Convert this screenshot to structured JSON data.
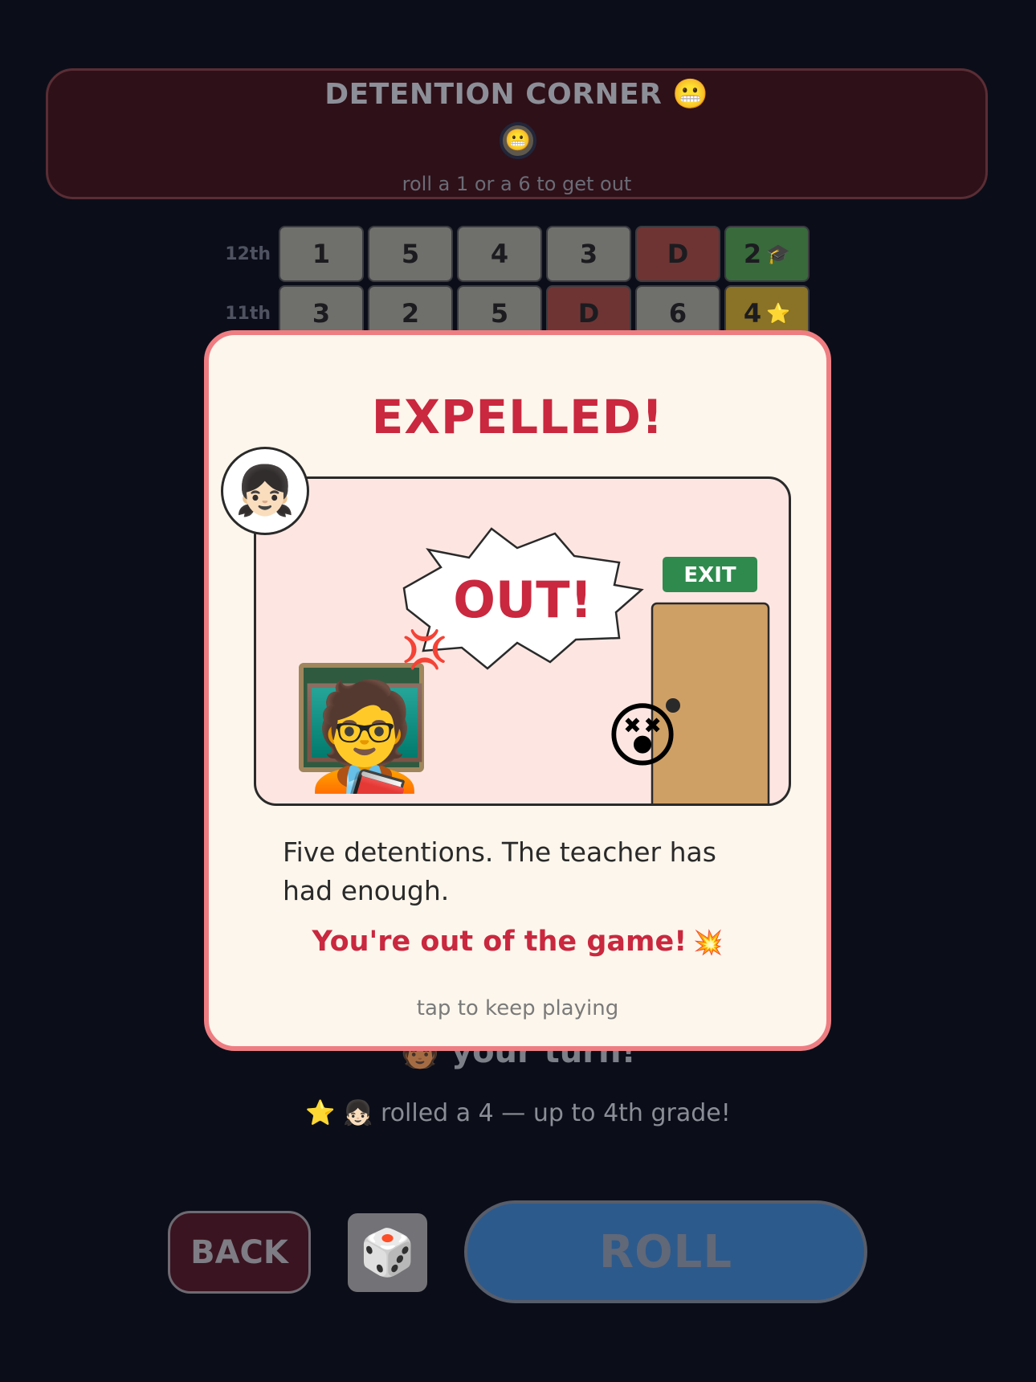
{
  "detention_corner": {
    "title": "DETENTION CORNER 😬",
    "avatar": "😬",
    "hint": "roll a 1 or a 6 to get out"
  },
  "board": {
    "rows": [
      {
        "label": "12th",
        "cells": [
          {
            "value": "1",
            "kind": "normal",
            "mark": ""
          },
          {
            "value": "5",
            "kind": "normal",
            "mark": ""
          },
          {
            "value": "4",
            "kind": "normal",
            "mark": ""
          },
          {
            "value": "3",
            "kind": "normal",
            "mark": ""
          },
          {
            "value": "D",
            "kind": "detention",
            "mark": ""
          },
          {
            "value": "2",
            "kind": "graduation",
            "mark": "🎓"
          }
        ]
      },
      {
        "label": "11th",
        "cells": [
          {
            "value": "3",
            "kind": "normal",
            "mark": ""
          },
          {
            "value": "2",
            "kind": "normal",
            "mark": ""
          },
          {
            "value": "5",
            "kind": "normal",
            "mark": ""
          },
          {
            "value": "D",
            "kind": "detention",
            "mark": ""
          },
          {
            "value": "6",
            "kind": "normal",
            "mark": ""
          },
          {
            "value": "4",
            "kind": "star",
            "mark": "⭐"
          }
        ]
      }
    ]
  },
  "turn": {
    "avatar": "🧑🏾",
    "text": "your turn!"
  },
  "status_message": "⭐ 👧🏻 rolled a 4 — up to 4th grade!",
  "controls": {
    "back_label": "BACK",
    "die_icon": "🎲",
    "roll_label": "ROLL"
  },
  "modal": {
    "title": "EXPELLED!",
    "player_avatar": "👧🏻",
    "scene": {
      "speech": "OUT!",
      "exit_sign": "EXIT",
      "teacher": "🧑‍🏫",
      "anger": "💢",
      "student": "😵"
    },
    "body": "Five detentions. The teacher has had enough.",
    "out_message": "You're out of the game!",
    "out_icon": "💥",
    "tap_hint": "tap to keep playing"
  },
  "colors": {
    "background": "#0b0e19",
    "modal_border": "#ee7d82",
    "accent_red": "#c9283f",
    "exit_green": "#2f8a4e",
    "door": "#cfa066",
    "roll_blue": "#2d5a8c"
  }
}
